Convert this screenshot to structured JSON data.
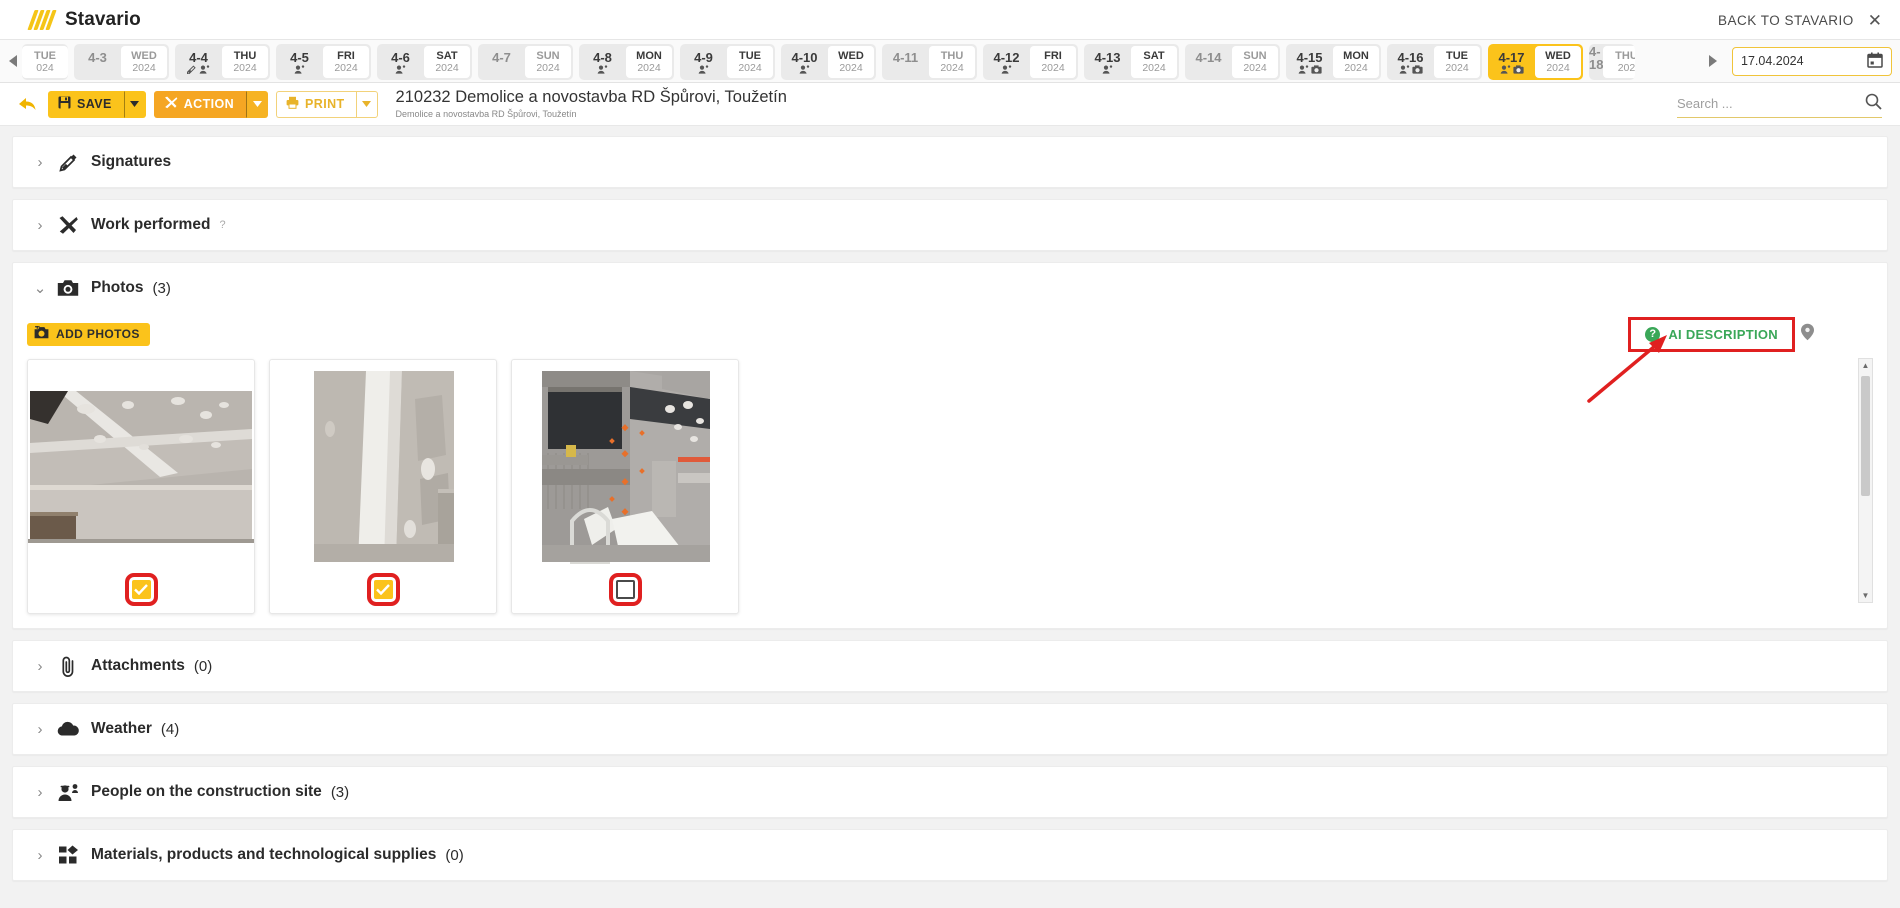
{
  "topbar": {
    "brand": "Stavario",
    "back_label": "BACK TO STAVARIO",
    "close_icon": "close-icon"
  },
  "datestrip": {
    "prev_icon": "chevron-left-icon",
    "next_icon": "chevron-right-icon",
    "date_value": "17.04.2024",
    "calendar_icon": "calendar-icon",
    "days": [
      {
        "num": "",
        "dow": "TUE",
        "year": "024",
        "selected": false,
        "dim": true,
        "icons": [],
        "partial": true
      },
      {
        "num": "4-3",
        "dow": "WED",
        "year": "2024",
        "selected": false,
        "dim": true,
        "icons": []
      },
      {
        "num": "4-4",
        "dow": "THU",
        "year": "2024",
        "selected": false,
        "dim": false,
        "icons": [
          "pen",
          "person"
        ]
      },
      {
        "num": "4-5",
        "dow": "FRI",
        "year": "2024",
        "selected": false,
        "dim": false,
        "icons": [
          "person"
        ]
      },
      {
        "num": "4-6",
        "dow": "SAT",
        "year": "2024",
        "selected": false,
        "dim": false,
        "icons": [
          "person"
        ]
      },
      {
        "num": "4-7",
        "dow": "SUN",
        "year": "2024",
        "selected": false,
        "dim": true,
        "icons": []
      },
      {
        "num": "4-8",
        "dow": "MON",
        "year": "2024",
        "selected": false,
        "dim": false,
        "icons": [
          "person"
        ]
      },
      {
        "num": "4-9",
        "dow": "TUE",
        "year": "2024",
        "selected": false,
        "dim": false,
        "icons": [
          "person"
        ]
      },
      {
        "num": "4-10",
        "dow": "WED",
        "year": "2024",
        "selected": false,
        "dim": false,
        "icons": [
          "person"
        ]
      },
      {
        "num": "4-11",
        "dow": "THU",
        "year": "2024",
        "selected": false,
        "dim": true,
        "icons": []
      },
      {
        "num": "4-12",
        "dow": "FRI",
        "year": "2024",
        "selected": false,
        "dim": false,
        "icons": [
          "person"
        ]
      },
      {
        "num": "4-13",
        "dow": "SAT",
        "year": "2024",
        "selected": false,
        "dim": false,
        "icons": [
          "person"
        ]
      },
      {
        "num": "4-14",
        "dow": "SUN",
        "year": "2024",
        "selected": false,
        "dim": true,
        "icons": []
      },
      {
        "num": "4-15",
        "dow": "MON",
        "year": "2024",
        "selected": false,
        "dim": false,
        "icons": [
          "person",
          "camera"
        ]
      },
      {
        "num": "4-16",
        "dow": "TUE",
        "year": "2024",
        "selected": false,
        "dim": false,
        "icons": [
          "person",
          "camera"
        ]
      },
      {
        "num": "4-17",
        "dow": "WED",
        "year": "2024",
        "selected": true,
        "dim": false,
        "icons": [
          "person",
          "camera"
        ]
      },
      {
        "num": "4-18",
        "dow": "THU",
        "year": "202",
        "selected": false,
        "dim": true,
        "icons": [],
        "partial": true
      }
    ]
  },
  "toolbar": {
    "undo_icon": "undo-arrow-icon",
    "save_label": "SAVE",
    "save_icon": "save-disk-icon",
    "action_label": "ACTION",
    "action_icon": "tools-icon",
    "print_label": "PRINT",
    "print_icon": "printer-icon",
    "caret_icon": "caret-down-icon",
    "title": "210232 Demolice a novostavba RD Špůrovi, Toužetín",
    "subtitle": "Demolice a novostavba RD Špůrovi, Toužetín",
    "search_placeholder": "Search ...",
    "search_value": "",
    "search_icon": "search-icon"
  },
  "sections": [
    {
      "id": "signatures",
      "title": "Signatures",
      "count": "",
      "icon": "pen-signature-icon",
      "expanded": false,
      "help": ""
    },
    {
      "id": "work",
      "title": "Work performed",
      "count": "",
      "icon": "hammer-wrench-icon",
      "expanded": false,
      "help": "?"
    },
    {
      "id": "photos",
      "title": "Photos",
      "count": "(3)",
      "icon": "camera-icon",
      "expanded": true,
      "help": ""
    },
    {
      "id": "attachments",
      "title": "Attachments",
      "count": "(0)",
      "icon": "paperclip-icon",
      "expanded": false,
      "help": ""
    },
    {
      "id": "weather",
      "title": "Weather",
      "count": "(4)",
      "icon": "cloud-icon",
      "expanded": false,
      "help": ""
    },
    {
      "id": "people",
      "title": "People on the construction site",
      "count": "(3)",
      "icon": "people-hardhat-icon",
      "expanded": false,
      "help": ""
    },
    {
      "id": "materials",
      "title": "Materials, products and technological supplies",
      "count": "(0)",
      "icon": "materials-blocks-icon",
      "expanded": false,
      "help": ""
    }
  ],
  "photos_panel": {
    "add_label": "ADD PHOTOS",
    "add_icon": "add-photo-icon",
    "ai_label": "AI DESCRIPTION",
    "ai_badge": "?",
    "pin_icon": "location-pin-icon",
    "scroll_up_icon": "caret-up-icon",
    "scroll_down_icon": "caret-down-icon",
    "items": [
      {
        "alt": "drywall-ceiling-photo",
        "checked": true
      },
      {
        "alt": "drywall-corner-photo",
        "checked": true
      },
      {
        "alt": "bathroom-walls-photo",
        "checked": false
      }
    ],
    "annotation": {
      "arrow_color": "#e02020",
      "highlight_color": "#e02020"
    }
  }
}
